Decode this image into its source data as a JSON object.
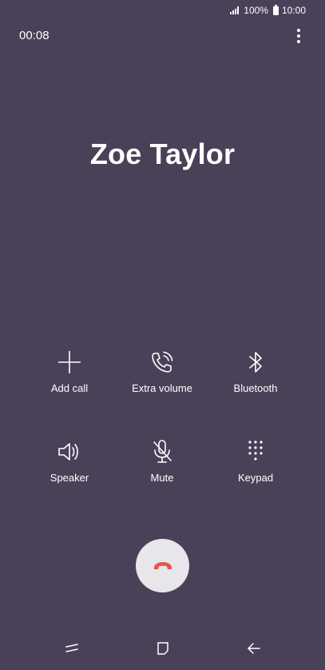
{
  "status_bar": {
    "battery_text": "100%",
    "time": "10:00",
    "icons": [
      "signal-icon",
      "battery-icon"
    ]
  },
  "call": {
    "timer": "00:08",
    "caller_name": "Zoe Taylor"
  },
  "controls": {
    "add_call": {
      "label": "Add call",
      "icon": "plus-icon"
    },
    "extra_volume": {
      "label": "Extra volume",
      "icon": "phone-volume-icon"
    },
    "bluetooth": {
      "label": "Bluetooth",
      "icon": "bluetooth-icon"
    },
    "speaker": {
      "label": "Speaker",
      "icon": "speaker-icon"
    },
    "mute": {
      "label": "Mute",
      "icon": "microphone-off-icon"
    },
    "keypad": {
      "label": "Keypad",
      "icon": "keypad-icon"
    }
  },
  "end_call": {
    "icon": "end-call-icon",
    "color": "#e0574f"
  },
  "nav_bar": {
    "icons": [
      "recent-apps-icon",
      "home-icon",
      "back-icon"
    ]
  },
  "colors": {
    "background": "#4a4158",
    "foreground": "#ffffff",
    "end_call_button": "#e8e6ea"
  }
}
